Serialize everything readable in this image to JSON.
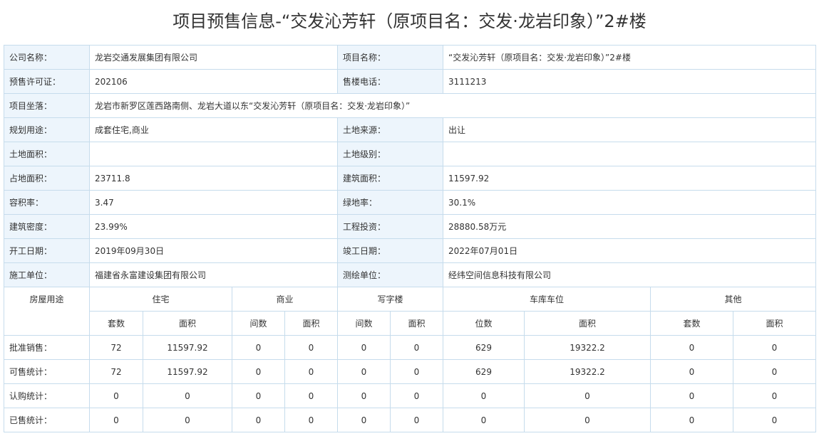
{
  "title": "项目预售信息-“交发沁芳轩（原项目名：交发·龙岩印象）”2#楼",
  "info_rows": [
    [
      {
        "label": "公司名称：",
        "value": "龙岩交通发展集团有限公司"
      },
      {
        "label": "项目名称：",
        "value": "“交发沁芳轩（原项目名：交发·龙岩印象）”2#楼"
      }
    ],
    [
      {
        "label": "预售许可证：",
        "value": "202106"
      },
      {
        "label": "售楼电话：",
        "value": "3111213"
      }
    ],
    [
      {
        "label": "项目坐落：",
        "value": "龙岩市新罗区莲西路南侧、龙岩大道以东“交发沁芳轩（原项目名：交发·龙岩印象）”"
      }
    ],
    [
      {
        "label": "规划用途：",
        "value": "成套住宅,商业"
      },
      {
        "label": "土地来源：",
        "value": "出让"
      }
    ],
    [
      {
        "label": "土地面积：",
        "value": ""
      },
      {
        "label": "土地级别：",
        "value": ""
      }
    ],
    [
      {
        "label": "占地面积：",
        "value": "23711.8"
      },
      {
        "label": "建筑面积：",
        "value": "11597.92"
      }
    ],
    [
      {
        "label": "容积率：",
        "value": "3.47"
      },
      {
        "label": "绿地率：",
        "value": "30.1%"
      }
    ],
    [
      {
        "label": "建筑密度：",
        "value": "23.99%"
      },
      {
        "label": "工程投资：",
        "value": "28880.58万元"
      }
    ],
    [
      {
        "label": "开工日期：",
        "value": "2019年09月30日"
      },
      {
        "label": "竣工日期：",
        "value": "2022年07月01日"
      }
    ],
    [
      {
        "label": "施工单位：",
        "value": "福建省永富建设集团有限公司"
      },
      {
        "label": "测绘单位：",
        "value": "经纬空间信息科技有限公司"
      }
    ]
  ],
  "usage_table": {
    "corner_label": "房屋用途",
    "groups": [
      "住宅",
      "商业",
      "写字楼",
      "车库车位",
      "其他"
    ],
    "subheaders": [
      "套数",
      "面积",
      "间数",
      "面积",
      "间数",
      "面积",
      "位数",
      "面积",
      "套数",
      "面积"
    ],
    "rows": [
      {
        "label": "批准销售：",
        "values": [
          "72",
          "11597.92",
          "0",
          "0",
          "0",
          "0",
          "629",
          "19322.2",
          "0",
          "0"
        ]
      },
      {
        "label": "可售统计：",
        "values": [
          "72",
          "11597.92",
          "0",
          "0",
          "0",
          "0",
          "629",
          "19322.2",
          "0",
          "0"
        ]
      },
      {
        "label": "认购统计：",
        "values": [
          "0",
          "0",
          "0",
          "0",
          "0",
          "0",
          "0",
          "0",
          "0",
          "0"
        ]
      },
      {
        "label": "已售统计：",
        "values": [
          "0",
          "0",
          "0",
          "0",
          "0",
          "0",
          "0",
          "0",
          "0",
          "0"
        ]
      }
    ]
  }
}
